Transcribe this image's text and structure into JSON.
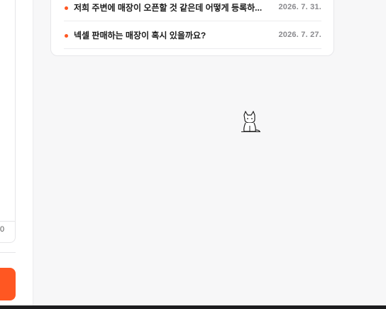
{
  "sidebar": {
    "count_text": "0"
  },
  "posts": [
    {
      "title": "저희 주변에 매장이 오픈할 것 같은데 어떻게 등록하...",
      "date": "2026. 7. 31."
    },
    {
      "title": "넥셀 판매하는 매장이 혹시 있을까요?",
      "date": "2026. 7. 27."
    }
  ],
  "colors": {
    "accent": "#ff5722",
    "date": "#8a8a8e"
  },
  "icons": {
    "mascot": "cat-mascot-icon"
  }
}
